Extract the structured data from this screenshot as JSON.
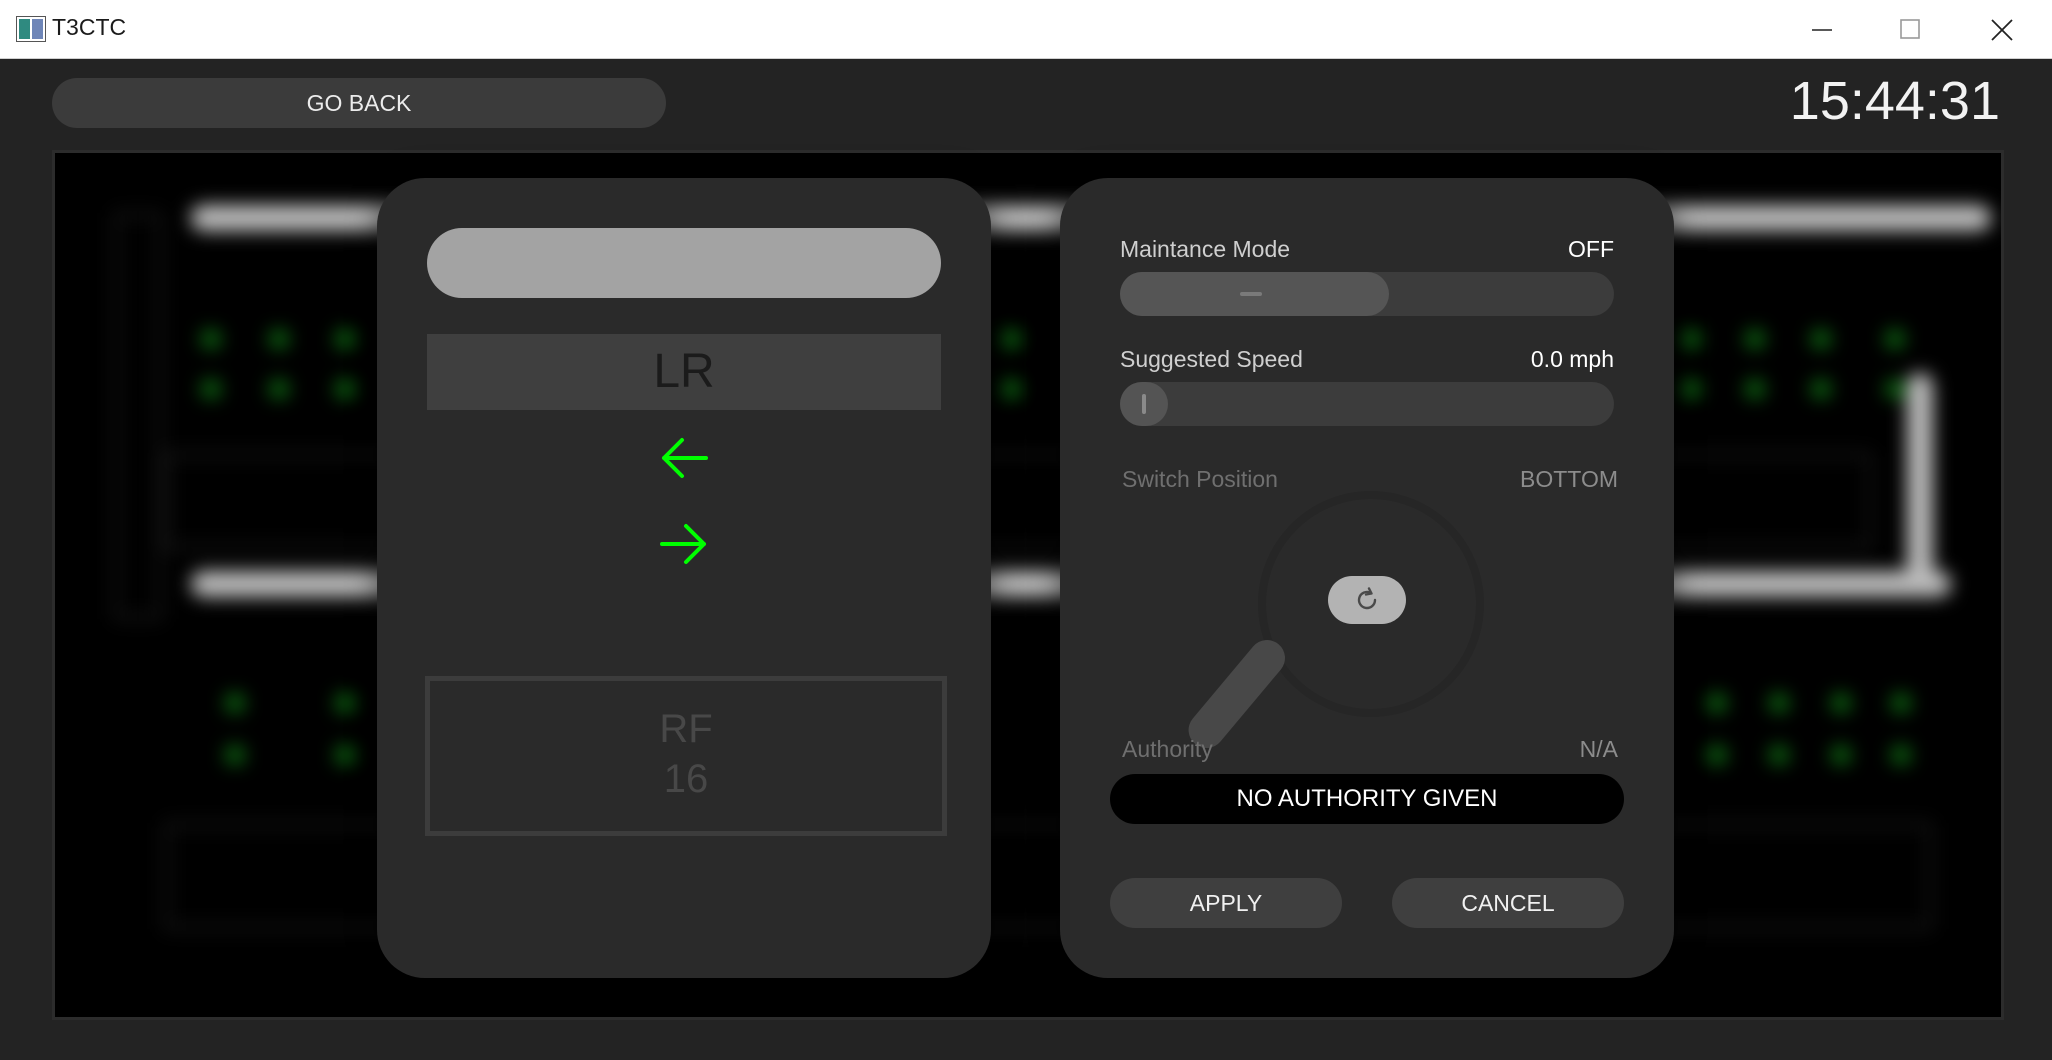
{
  "window": {
    "title": "T3CTC"
  },
  "header": {
    "go_back_label": "GO BACK",
    "clock": "15:44:31"
  },
  "block_panel": {
    "block_name": "",
    "line": "LR",
    "arrow_left": "←",
    "arrow_right": "→",
    "rf_label": "RF",
    "rf_number": "16",
    "arrow_color": "#00ff00"
  },
  "settings_panel": {
    "maintenance": {
      "label": "Maintance Mode",
      "value": "OFF",
      "toggle_level": 0.5
    },
    "suggested_speed": {
      "label": "Suggested Speed",
      "value": "0.0 mph",
      "slider_level": 0
    },
    "switch_position": {
      "label": "Switch Position",
      "value": "BOTTOM"
    },
    "authority": {
      "label": "Authority",
      "value": "N/A",
      "message": "NO AUTHORITY GIVEN"
    },
    "apply_label": "APPLY",
    "cancel_label": "CANCEL"
  }
}
